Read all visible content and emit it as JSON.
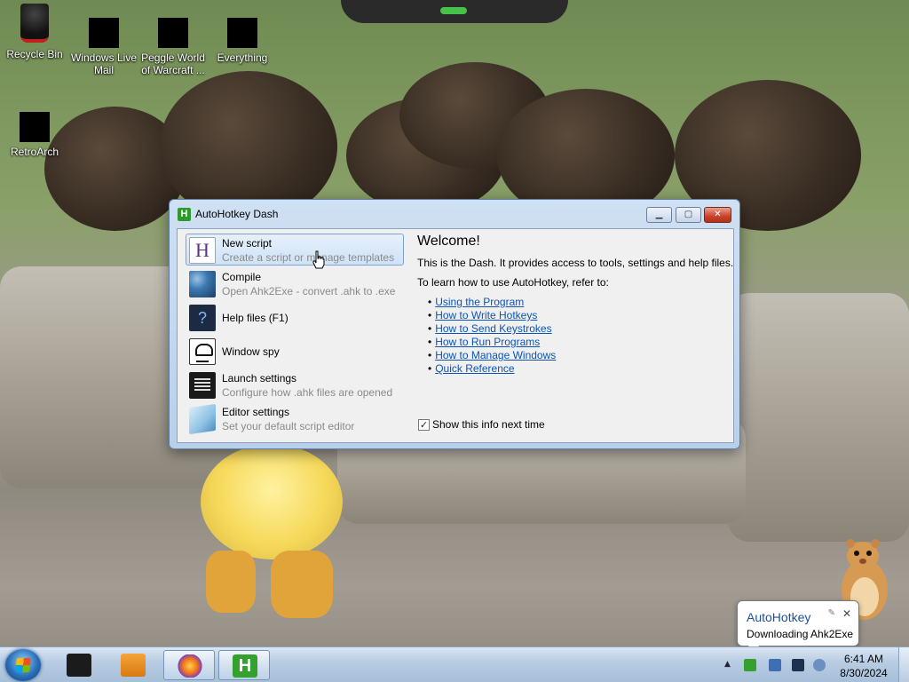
{
  "desktop": {
    "icons": [
      {
        "label": "Recycle Bin",
        "icon": "recycle-bin-icon"
      },
      {
        "label": "Windows Live Mail",
        "icon": "mail-icon"
      },
      {
        "label": "Peggle World of Warcraft ...",
        "icon": "peggle-icon"
      },
      {
        "label": "Everything",
        "icon": "everything-icon"
      },
      {
        "label": "RetroArch",
        "icon": "retroarch-icon"
      }
    ]
  },
  "window": {
    "title": "AutoHotkey Dash",
    "app_icon": "H",
    "buttons": {
      "minimize": "minimize-icon",
      "maximize": "maximize-icon",
      "close": "close-icon"
    },
    "menu": [
      {
        "label": "New script",
        "sub": "Create a script or manage templates",
        "icon": "H",
        "selected": true
      },
      {
        "label": "Compile",
        "sub": "Open Ahk2Exe - convert .ahk to .exe",
        "icon": "compile-icon"
      },
      {
        "label": "Help files (F1)",
        "sub": "",
        "icon": "?"
      },
      {
        "label": "Window spy",
        "sub": "",
        "icon": "spy-icon"
      },
      {
        "label": "Launch settings",
        "sub": "Configure how .ahk files are opened",
        "icon": "launch-icon"
      },
      {
        "label": "Editor settings",
        "sub": "Set your default script editor",
        "icon": "editor-icon"
      }
    ],
    "welcome": {
      "heading": "Welcome!",
      "intro": "This is the Dash. It provides access to tools, settings and help files.",
      "learn": "To learn how to use AutoHotkey, refer to:",
      "links": [
        "Using the Program",
        "How to Write Hotkeys",
        "How to Send Keystrokes",
        "How to Run Programs",
        "How to Manage Windows",
        "Quick Reference"
      ],
      "show_info": {
        "label": "Show this info next time",
        "checked": true,
        "mark": "✓"
      }
    }
  },
  "taskbar": {
    "apps": [
      "black-app-icon",
      "media-player-icon",
      "firefox-icon",
      "autohotkey-icon"
    ],
    "ahk_glyph": "H",
    "tray": {
      "arrow": "▲"
    },
    "clock": {
      "time": "6:41 AM",
      "date": "8/30/2024"
    }
  },
  "balloon": {
    "title": "AutoHotkey",
    "message": "Downloading Ahk2Exe",
    "close": "✕",
    "pin": "✎"
  }
}
